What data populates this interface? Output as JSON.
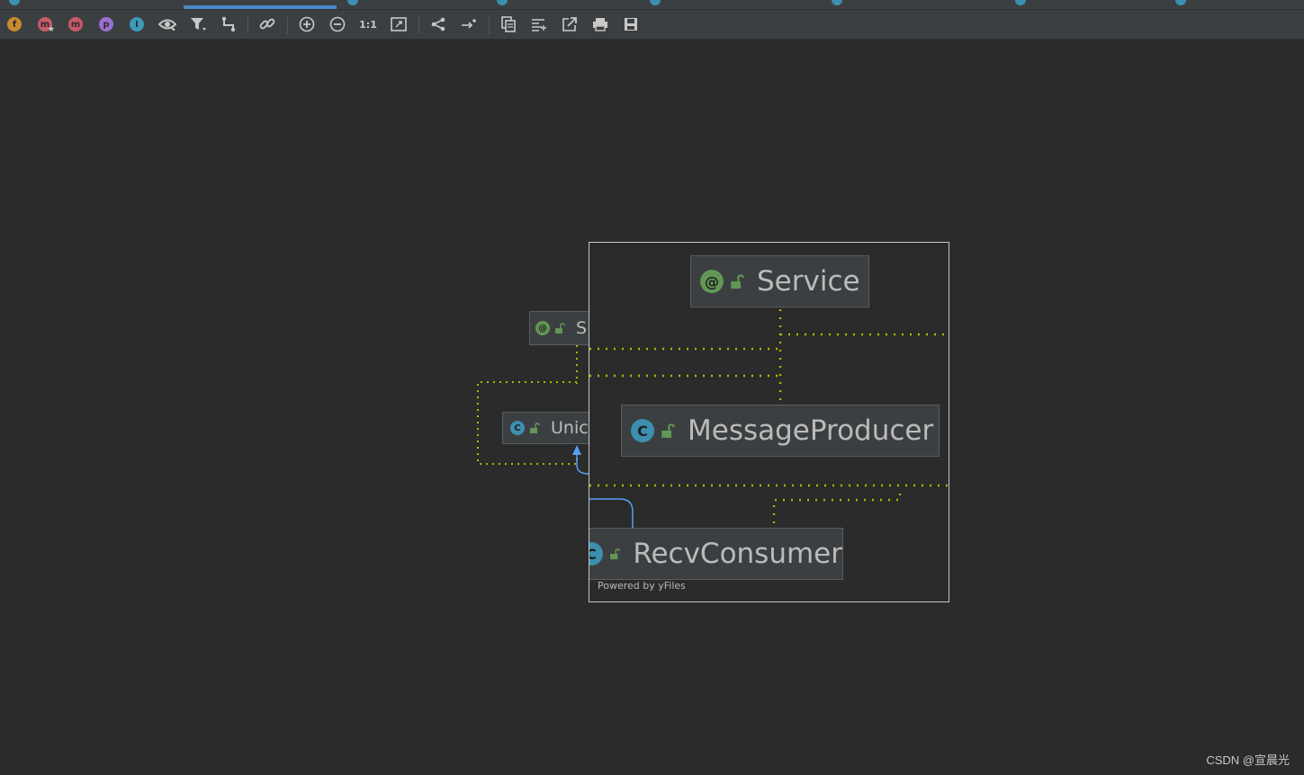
{
  "toolbar": {
    "buttons": [
      {
        "name": "fields-filter-button",
        "letter": "f",
        "color": "#c78a2e"
      },
      {
        "name": "constructors-filter-button",
        "letter": "m",
        "color": "#c75a6a"
      },
      {
        "name": "methods-filter-button",
        "letter": "m",
        "color": "#c75a6a"
      },
      {
        "name": "properties-filter-button",
        "letter": "p",
        "color": "#9b6fd1"
      },
      {
        "name": "inner-classes-filter-button",
        "letter": "I",
        "color": "#3d9ab8"
      }
    ],
    "zoom_actual_label": "1:1"
  },
  "diagram": {
    "nodes": {
      "service": {
        "label": "Service",
        "icon": "annotation-icon",
        "icon_letter": "@",
        "icon_color": "#629755"
      },
      "message_producer": {
        "label": "MessageProducer",
        "icon": "class-icon",
        "icon_letter": "C",
        "icon_color": "#3d8fb0"
      },
      "recv_consumer": {
        "label": "RecvConsumer",
        "icon": "class-icon",
        "icon_letter": "C",
        "icon_color": "#3d8fb0"
      },
      "service_partial": {
        "label": "S",
        "icon": "annotation-icon",
        "icon_letter": "@"
      },
      "union_partial": {
        "label": "Unic",
        "icon": "class-icon",
        "icon_letter": "C"
      }
    },
    "powered_by": "Powered by yFiles",
    "colors": {
      "dependency_line": "#b4b400",
      "inheritance_line": "#589df6",
      "lock_icon": "#629755"
    }
  },
  "watermark": "CSDN @宣晨光"
}
